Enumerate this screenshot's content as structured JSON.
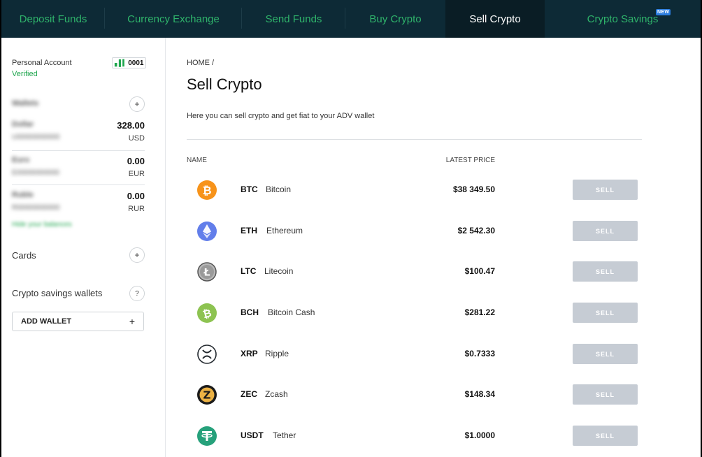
{
  "nav": {
    "tabs": [
      {
        "label": "Deposit Funds"
      },
      {
        "label": "Currency Exchange"
      },
      {
        "label": "Send Funds"
      },
      {
        "label": "Buy Crypto"
      },
      {
        "label": "Sell Crypto",
        "active": true
      },
      {
        "label": "Crypto Savings",
        "badge": "NEW"
      }
    ]
  },
  "sidebar": {
    "account_label": "Personal Account",
    "account_status": "Verified",
    "account_id": "0001",
    "wallets_title": "Wallets",
    "wallets": [
      {
        "name": "Dollar",
        "number": "U00000000000",
        "amount": "328.00",
        "currency": "USD"
      },
      {
        "name": "Euro",
        "number": "E00000000000",
        "amount": "0.00",
        "currency": "EUR"
      },
      {
        "name": "Ruble",
        "number": "R00000000000",
        "amount": "0.00",
        "currency": "RUR"
      }
    ],
    "hide_balances": "Hide your balances",
    "cards_label": "Cards",
    "savings_label": "Crypto savings wallets",
    "add_wallet_label": "ADD WALLET"
  },
  "main": {
    "breadcrumb": "HOME /",
    "title": "Sell Crypto",
    "subtitle": "Here you can sell crypto and get fiat to your ADV wallet",
    "col_name": "NAME",
    "col_price": "LATEST PRICE",
    "sell_label": "SELL",
    "coins": [
      {
        "symbol": "BTC",
        "name": "Bitcoin",
        "price": "$38 349.50",
        "icon": "bitcoin-icon",
        "color": "#f7931a"
      },
      {
        "symbol": "ETH",
        "name": "Ethereum",
        "price": "$2 542.30",
        "icon": "ethereum-icon",
        "color": "#627eea"
      },
      {
        "symbol": "LTC",
        "name": "Litecoin",
        "price": "$100.47",
        "icon": "litecoin-icon",
        "color": "#838383"
      },
      {
        "symbol": "BCH",
        "name": "Bitcoin Cash",
        "price": "$281.22",
        "icon": "bitcoin-cash-icon",
        "color": "#8dc351"
      },
      {
        "symbol": "XRP",
        "name": "Ripple",
        "price": "$0.7333",
        "icon": "ripple-icon",
        "color": "#23292f"
      },
      {
        "symbol": "ZEC",
        "name": "Zcash",
        "price": "$148.34",
        "icon": "zcash-icon",
        "color": "#ecb244"
      },
      {
        "symbol": "USDT",
        "name": "Tether",
        "price": "$1.0000",
        "icon": "tether-icon",
        "color": "#26a17b"
      }
    ]
  },
  "colors": {
    "nav_bg": "#0d2a36",
    "nav_active_bg": "#0a1d25",
    "accent_green": "#2fb46b",
    "sell_button": "#c6ccd4"
  }
}
